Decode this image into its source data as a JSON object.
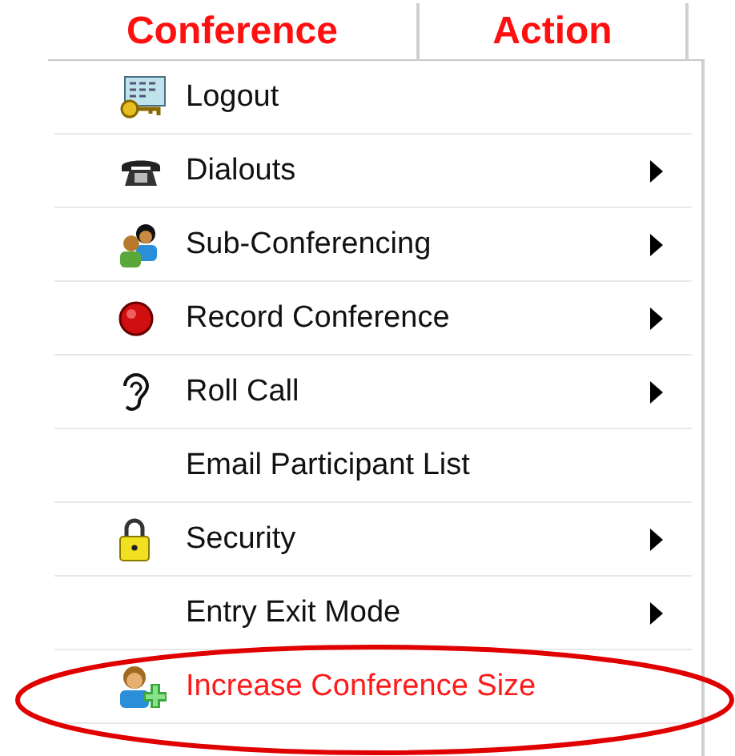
{
  "header": {
    "columns": [
      {
        "label": "Conference"
      },
      {
        "label": "Action"
      }
    ]
  },
  "menu": {
    "items": [
      {
        "label": "Logout",
        "submenu": false,
        "highlighted": false
      },
      {
        "label": "Dialouts",
        "submenu": true,
        "highlighted": false
      },
      {
        "label": "Sub-Conferencing",
        "submenu": true,
        "highlighted": false
      },
      {
        "label": "Record Conference",
        "submenu": true,
        "highlighted": false
      },
      {
        "label": "Roll Call",
        "submenu": true,
        "highlighted": false
      },
      {
        "label": "Email Participant List",
        "submenu": false,
        "highlighted": false
      },
      {
        "label": "Security",
        "submenu": true,
        "highlighted": false
      },
      {
        "label": "Entry Exit Mode",
        "submenu": true,
        "highlighted": false
      },
      {
        "label": "Increase Conference Size",
        "submenu": false,
        "highlighted": true
      }
    ]
  }
}
